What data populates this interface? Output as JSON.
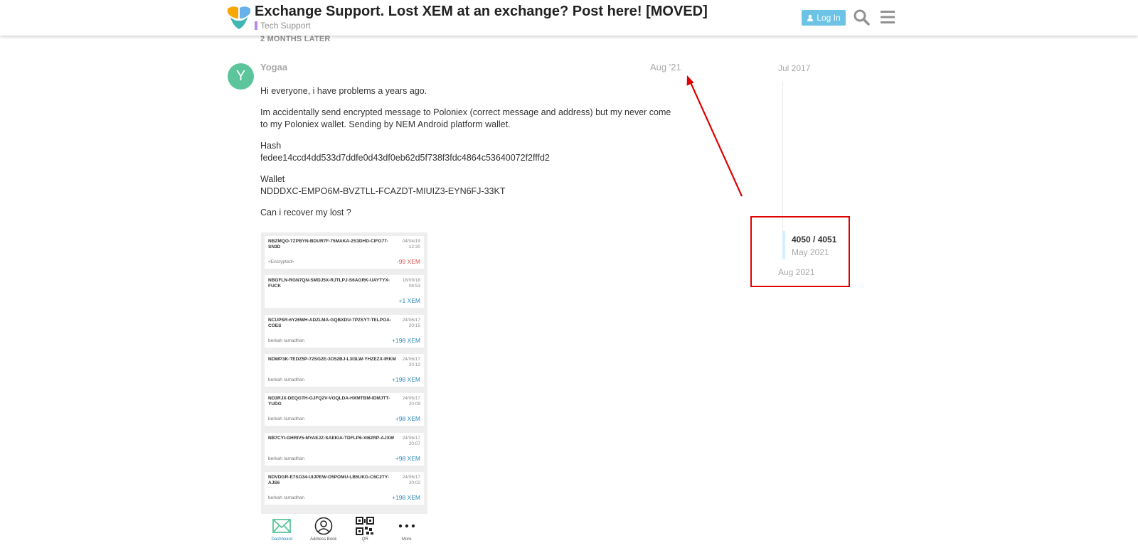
{
  "header": {
    "title": "Exchange Support. Lost XEM at an exchange? Post here! [MOVED]",
    "category": "Tech Support",
    "login_label": "Log In",
    "colors": {
      "category": "#b58be6",
      "login_bg": "#6cc3e6"
    }
  },
  "time_gap": "2 MONTHS LATER",
  "post": {
    "avatar_letter": "Y",
    "username": "Yogaa",
    "date": "Aug '21",
    "paragraphs": [
      "Hi everyone, i have problems a years ago.",
      "Im accidentally send encrypted message to Poloniex (correct message and address) but my never come to my Poloniex wallet. Sending by NEM Android platform wallet."
    ],
    "hash_label": "Hash",
    "hash_value": "fedee14ccd4dd533d7ddfe0d43df0eb62d5f738f3fdc4864c53640072f2fffd2",
    "wallet_label": "Wallet",
    "wallet_value": "NDDDXC-EMPO6M-BVZTLL-FCAZDT-MIUIZ3-EYN6FJ-33KT",
    "question": "Can i recover my lost ?"
  },
  "screenshot": {
    "transactions": [
      {
        "addr": "NBZMQO-7ZPBYN-BDUR7F-75MAKA-2S3DHD-CIFG77-SN3D",
        "date": "04/04/19",
        "time": "12:30",
        "sender": "<Encrypted>",
        "amount": "-99",
        "unit": "XEM",
        "negative": true
      },
      {
        "addr": "NBGFLN-RGN7QN-SMDJ5X-RJTLPJ-S6AGRK-UAYTYX-FUCK",
        "date": "18/09/18",
        "time": "08:53",
        "sender": "",
        "amount": "+1",
        "unit": "XEM",
        "negative": false
      },
      {
        "addr": "NCUPSR-6Y26WH-ADZLMA-GQBXDU-7PZSYT-TELPOA-COES",
        "date": "24/06/17",
        "time": "20:15",
        "sender": "berkah ramadhan",
        "amount": "+198",
        "unit": "XEM",
        "negative": false
      },
      {
        "addr": "NDWP3K-TEDZ5P-72SG2E-3O52BJ-L3I3LW-YHZEZX-IRKM",
        "date": "24/06/17",
        "time": "20:12",
        "sender": "berkah ramadhan",
        "amount": "+198",
        "unit": "XEM",
        "negative": false
      },
      {
        "addr": "ND3RJX-DEQGTH-GJFQ2V-VOQLDA-HXMTBM-IDMJTT-YUDG",
        "date": "24/06/17",
        "time": "20:09",
        "sender": "berkah ramadhan",
        "amount": "+98",
        "unit": "XEM",
        "negative": false
      },
      {
        "addr": "NB7CYI-GHRIV5-MYAEJZ-SAEKIA-TDFLP6-XI62RP-AJXW",
        "date": "24/06/17",
        "time": "20:07",
        "sender": "berkah ramadhan",
        "amount": "+98",
        "unit": "XEM",
        "negative": false
      },
      {
        "addr": "NDVDGR-E7SO34-UIJPEW-O5POMU-LB5UKG-C6C2TY-AJS6",
        "date": "24/06/17",
        "time": "20:02",
        "sender": "berkah ramadhan",
        "amount": "+198",
        "unit": "XEM",
        "negative": false
      }
    ],
    "nav": [
      {
        "label": "Dashboard",
        "icon": "envelope-icon",
        "active": true
      },
      {
        "label": "Address Book",
        "icon": "person-icon",
        "active": false
      },
      {
        "label": "QR",
        "icon": "qr-code-icon",
        "active": false
      },
      {
        "label": "More",
        "icon": "more-dots-icon",
        "active": false
      }
    ]
  },
  "timeline": {
    "start": "Jul 2017",
    "count": "4050 / 4051",
    "handle_date": "May 2021",
    "end": "Aug 2021",
    "progress": 0.9998
  },
  "annotation_colors": {
    "box": "#e00000",
    "arrow": "#e00000"
  }
}
